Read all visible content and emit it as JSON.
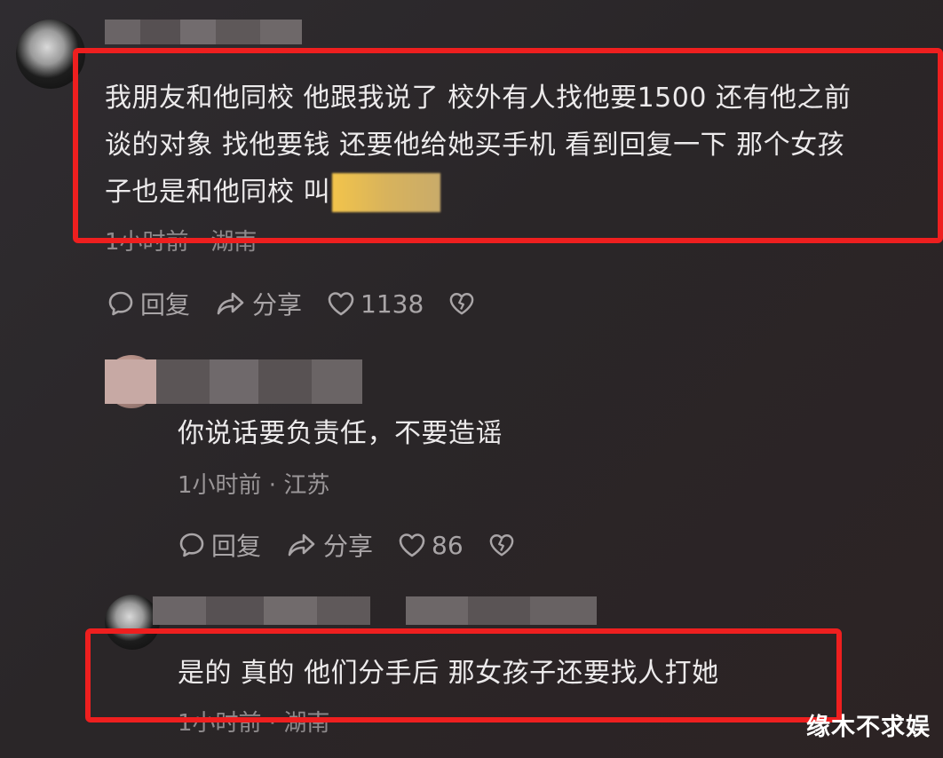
{
  "comments": [
    {
      "text_line1": "我朋友和他同校 他跟我说了 校外有人找他要1500 还有他之前",
      "text_line2": "谈的对象 找他要钱 还要他给她买手机 看到回复一下 那个女孩",
      "text_line3": "子也是和他同校 叫",
      "meta": "1小时前 · 湖南",
      "reply_label": "回复",
      "share_label": "分享",
      "like_count": "1138"
    },
    {
      "text": "你说话要负责任，不要造谣",
      "meta": "1小时前 · 江苏",
      "reply_label": "回复",
      "share_label": "分享",
      "like_count": "86"
    },
    {
      "text": "是的 真的 他们分手后 那女孩子还要找人打她",
      "meta": "1小时前 · 湖南"
    }
  ],
  "watermark": "缘木不求娱",
  "icons": [
    "comment-icon",
    "share-icon",
    "heart-icon",
    "dislike-icon"
  ],
  "colors": {
    "highlight_box": "#ee1f1f",
    "background": "#2b2729"
  }
}
